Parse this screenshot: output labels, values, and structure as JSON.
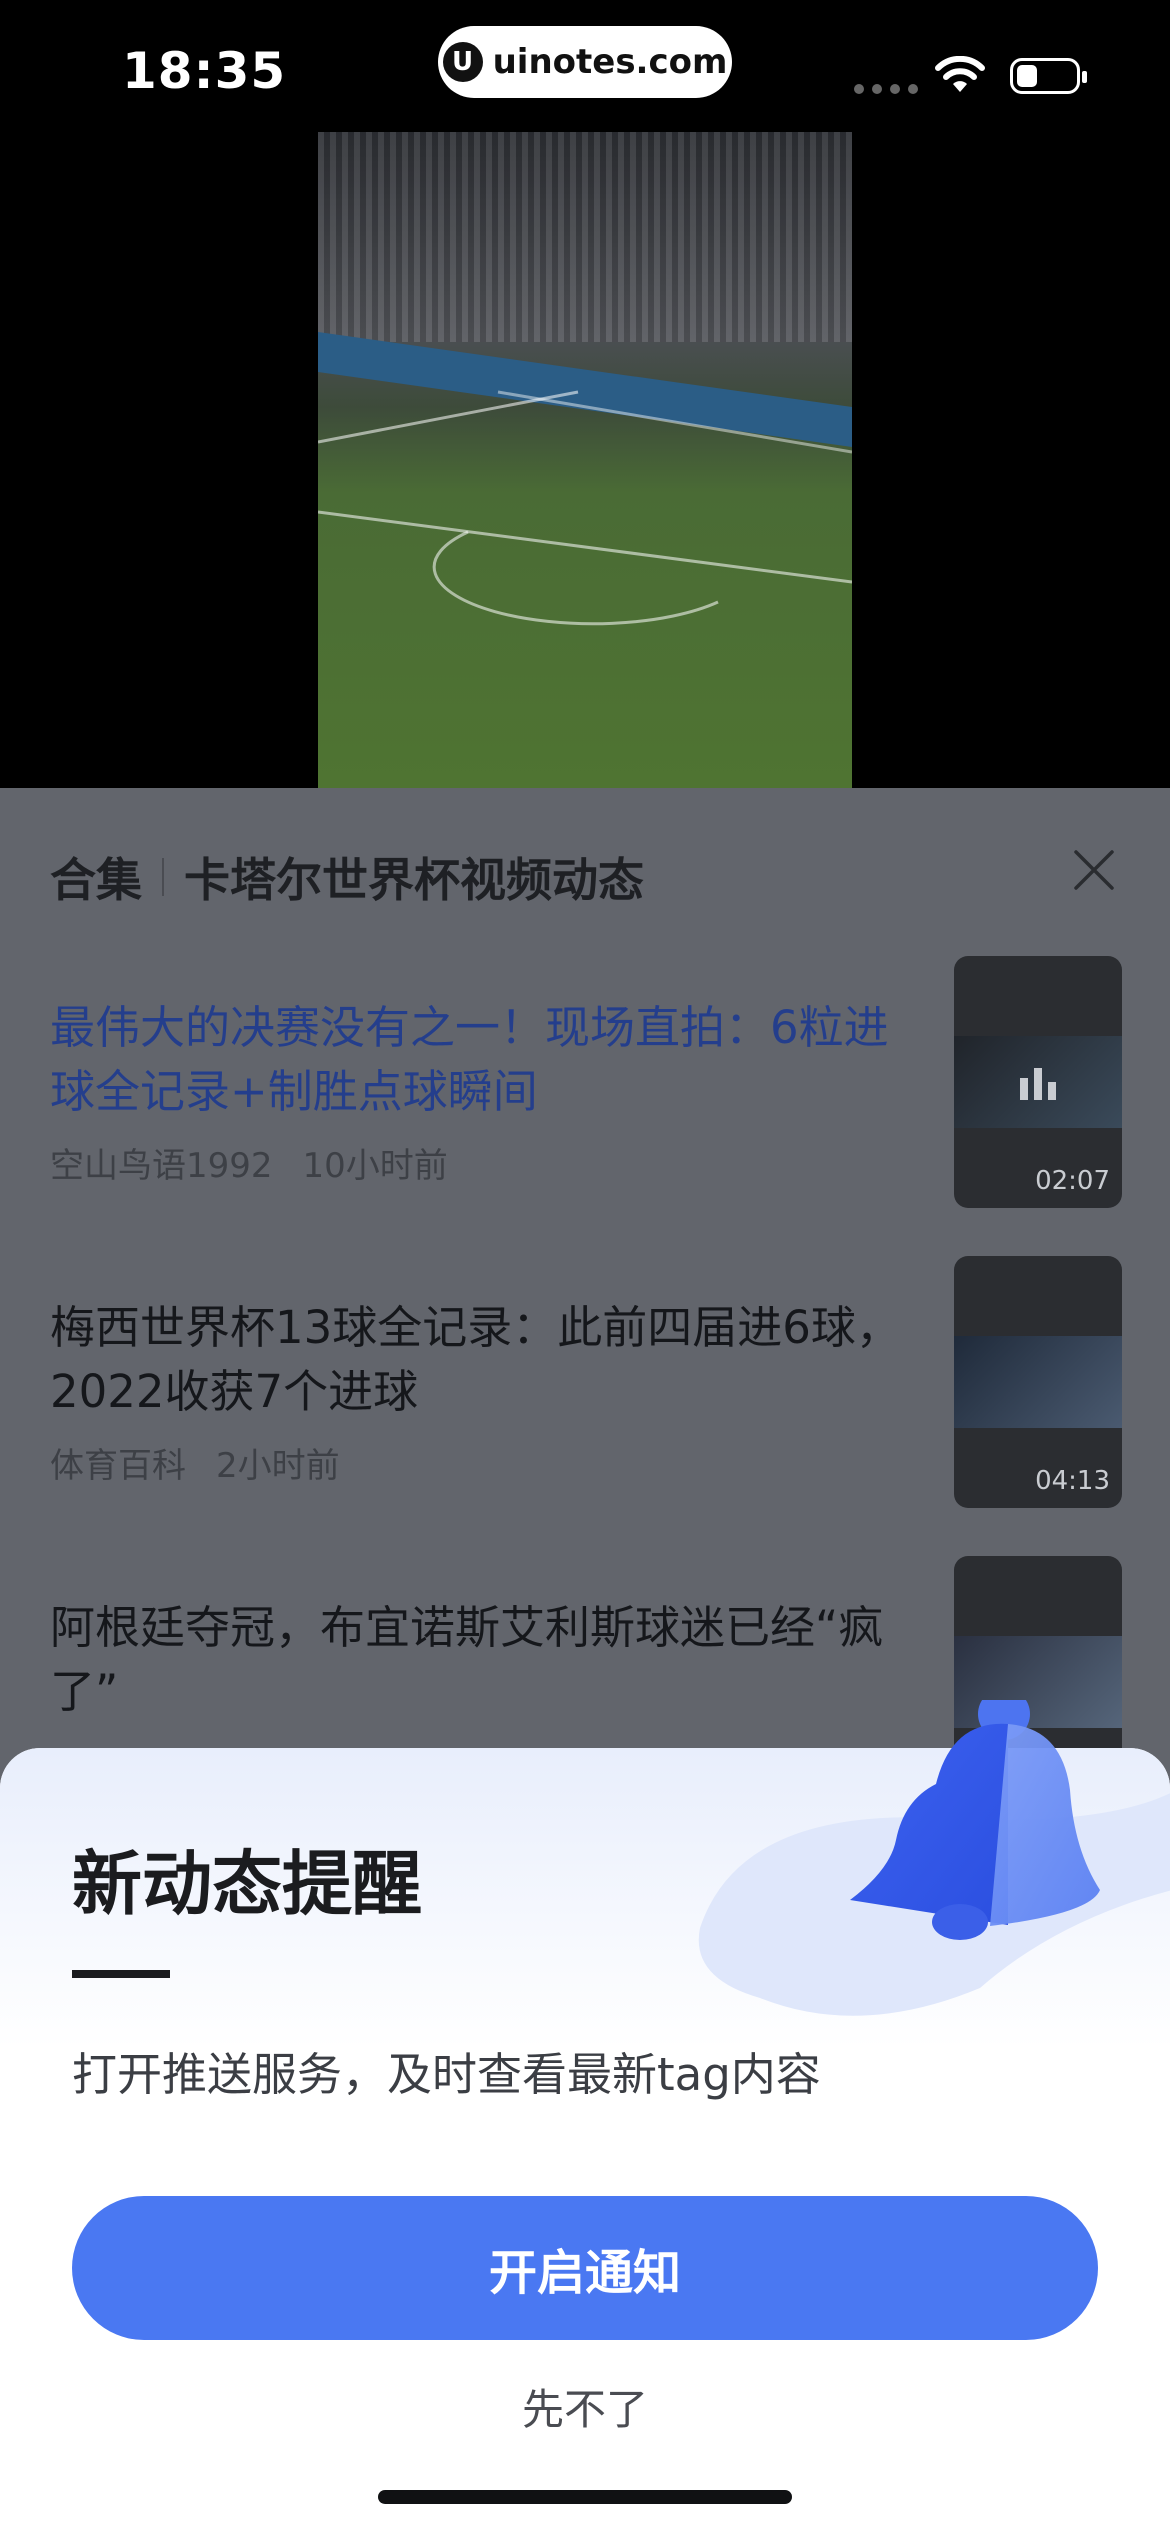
{
  "status_bar": {
    "time": "18:35",
    "url": "uinotes.com",
    "url_logo": "U",
    "icons": [
      "signal-dots-icon",
      "wifi-icon",
      "battery-icon"
    ]
  },
  "collection": {
    "tag": "合集",
    "title": "卡塔尔世界杯视频动态",
    "items": [
      {
        "title": "最伟大的决赛没有之一！现场直拍：6粒进球全记录+制胜点球瞬间",
        "author": "空山鸟语1992",
        "time": "10小时前",
        "duration": "02:07",
        "active": true
      },
      {
        "title": "梅西世界杯13球全记录：此前四届进6球，2022收获7个进球",
        "author": "体育百科",
        "time": "2小时前",
        "duration": "04:13",
        "active": false
      },
      {
        "title": "阿根廷夺冠，布宜诺斯艾利斯球迷已经“疯了”",
        "author": "",
        "time": "",
        "duration": "",
        "active": false
      }
    ]
  },
  "notification_sheet": {
    "title": "新动态提醒",
    "description": "打开推送服务，及时查看最新tag内容",
    "enable_label": "开启通知",
    "skip_label": "先不了"
  },
  "colors": {
    "accent": "#4a78f2",
    "active_title": "#243e8c"
  }
}
